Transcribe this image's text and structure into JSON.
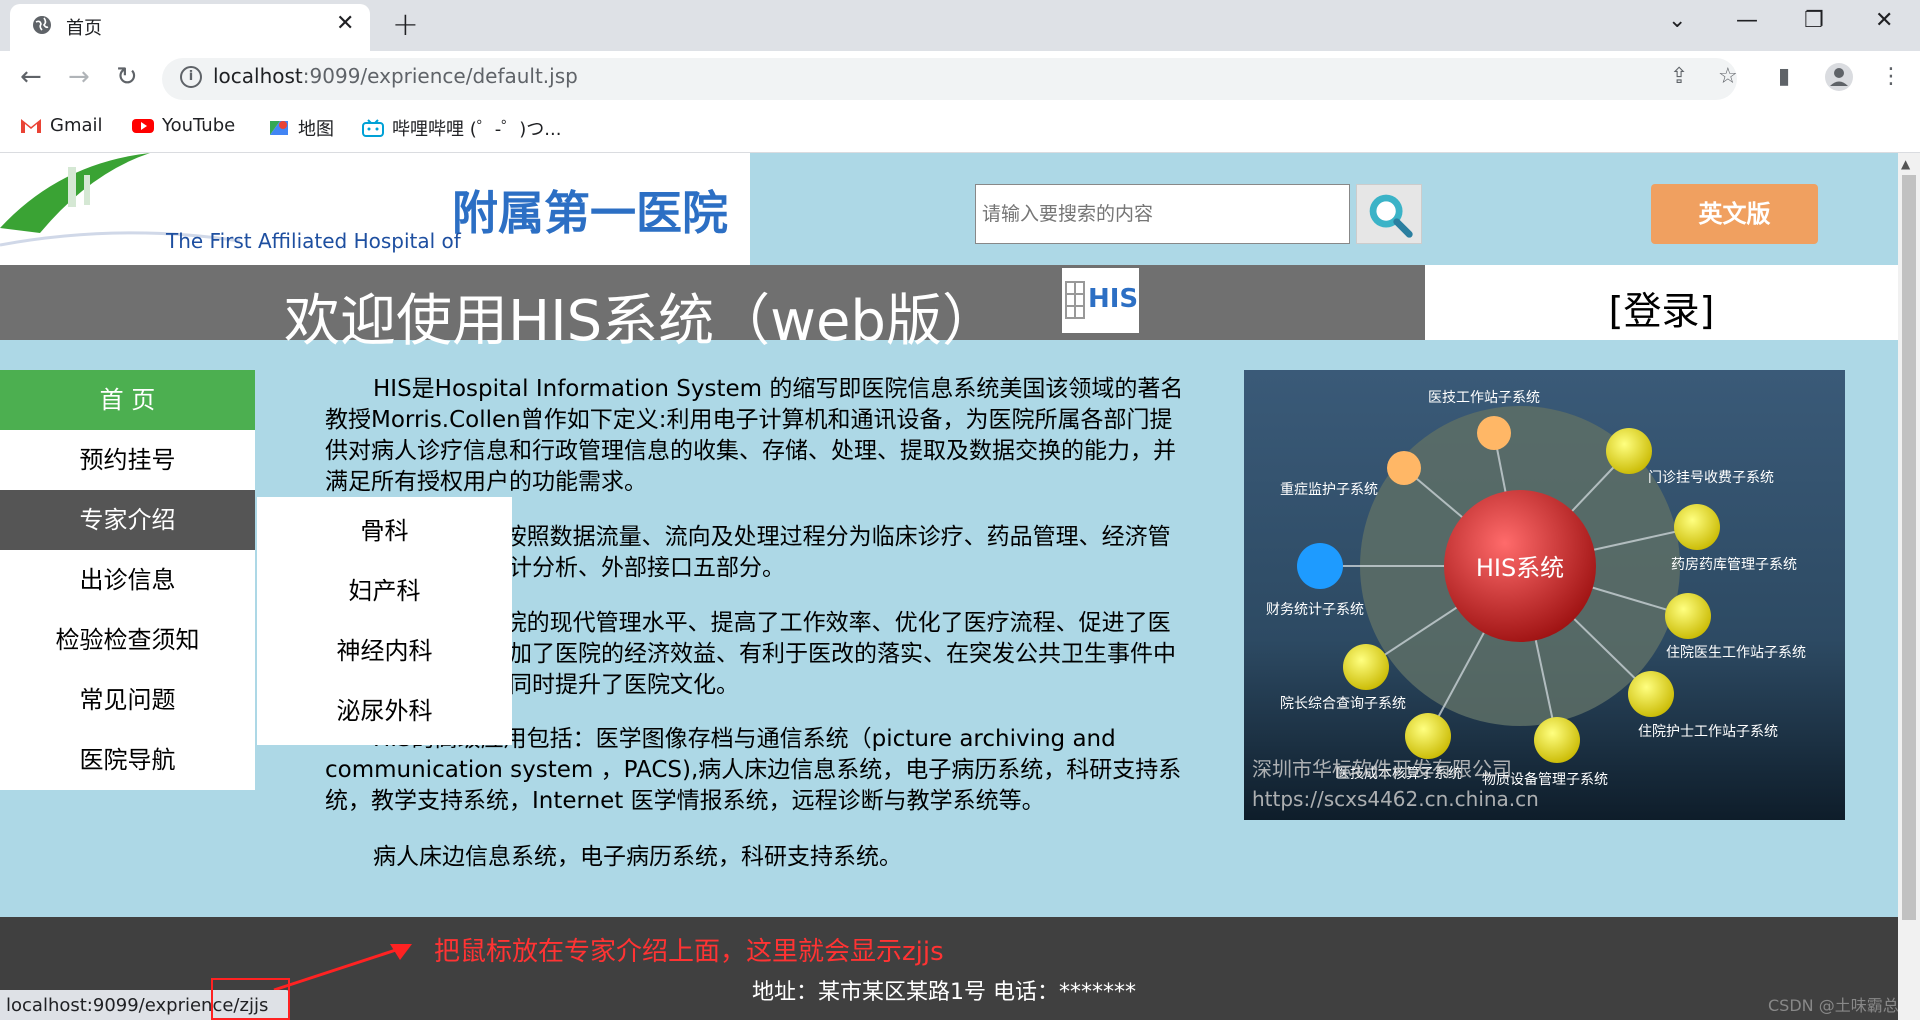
{
  "browser": {
    "tab_title": "首页",
    "url_host": "localhost",
    "url_path": ":9099/exprience/default.jsp",
    "bookmarks": [
      "Gmail",
      "YouTube",
      "地图",
      "哔哩哔哩 (゜-゜)つ..."
    ]
  },
  "header": {
    "logo_cn": "附属第一医院",
    "logo_en": "The First Affiliated Hospital of",
    "search_placeholder": "请输入要搜索的内容",
    "english_button": "英文版"
  },
  "banner": {
    "title": "欢迎使用HIS系统（web版）",
    "his_logo": "HIS",
    "login": "[登录]"
  },
  "sidebar": {
    "items": [
      "首 页",
      "预约挂号",
      "专家介绍",
      "出诊信息",
      "检验检查须知",
      "常见问题",
      "医院导航"
    ],
    "active": 0,
    "hovered": 2
  },
  "submenu": {
    "items": [
      "骨科",
      "妇产科",
      "神经内科",
      "泌尿外科"
    ]
  },
  "content": {
    "p1": "HIS是Hospital Information System 的缩写即医院信息系统美国该领域的著名教授Morris.Collen曾作如下定义:利用电子计算机和通讯设备，为医院所属各部门提供对病人诊疗信息和行政管理信息的收集、存储、处理、提取及数据交换的能力，并满足所有授权用户的功能需求。",
    "p2": "HIS系统功能按照数据流量、流向及处理过程分为临床诊疗、药品管理、经济管理、综合管理与统计分析、外部接口五部分。",
    "p3": "HIS提高了医院的现代管理水平、提高了工作效率、优化了医疗流程、促进了医疗质量的提高、增加了医院的经济效益、有利于医改的落实、在突发公共卫生事件中起了特有的作用，同时提升了医院文化。",
    "p4": "HIS的高级应用包括：医学图像存档与通信系统（picture archiving and communication system ，PACS),病人床边信息系统，电子病历系统，科研支持系统，教学支持系统，Internet 医学情报系统，远程诊断与教学系统等。",
    "p5": "病人床边信息系统，电子病历系统，科研支持系统。"
  },
  "diagram": {
    "center": "HIS系统",
    "nodes": [
      "医技工作站子系统",
      "门诊挂号收费子系统",
      "药房药库管理子系统",
      "住院医生工作站子系统",
      "住院护士工作站子系统",
      "物质设备管理子系统",
      "医技成本核算子系统",
      "院长综合查询子系统",
      "财务统计子系统",
      "重症监护子系统"
    ],
    "watermark1": "深圳市华标软件开发有限公司",
    "watermark2": "https://scxs4462.cn.china.cn"
  },
  "footer": {
    "note": "把鼠标放在专家介绍上面，这里就会显示zjjs",
    "address": "地址：某市某区某路1号 电话：*******"
  },
  "status_url": "localhost:9099/exprience/zjjs",
  "watermark": "CSDN @土味霸总",
  "colors": {
    "page_bg": "#add8e6",
    "active_green": "#4caf50",
    "hover_gray": "#555555",
    "banner_gray": "#707070",
    "footer_dark": "#404040",
    "annotation_red": "#ff3333"
  }
}
